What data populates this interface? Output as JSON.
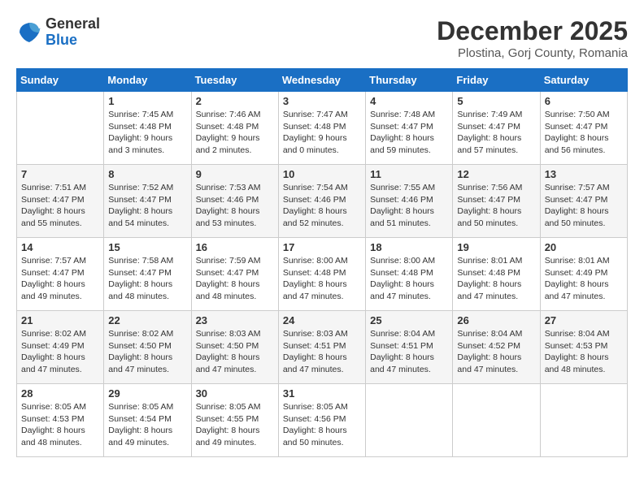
{
  "header": {
    "logo_general": "General",
    "logo_blue": "Blue",
    "month_year": "December 2025",
    "location": "Plostina, Gorj County, Romania"
  },
  "days_of_week": [
    "Sunday",
    "Monday",
    "Tuesday",
    "Wednesday",
    "Thursday",
    "Friday",
    "Saturday"
  ],
  "weeks": [
    [
      {
        "day": "",
        "sunrise": "",
        "sunset": "",
        "daylight": ""
      },
      {
        "day": "1",
        "sunrise": "Sunrise: 7:45 AM",
        "sunset": "Sunset: 4:48 PM",
        "daylight": "Daylight: 9 hours and 3 minutes."
      },
      {
        "day": "2",
        "sunrise": "Sunrise: 7:46 AM",
        "sunset": "Sunset: 4:48 PM",
        "daylight": "Daylight: 9 hours and 2 minutes."
      },
      {
        "day": "3",
        "sunrise": "Sunrise: 7:47 AM",
        "sunset": "Sunset: 4:48 PM",
        "daylight": "Daylight: 9 hours and 0 minutes."
      },
      {
        "day": "4",
        "sunrise": "Sunrise: 7:48 AM",
        "sunset": "Sunset: 4:47 PM",
        "daylight": "Daylight: 8 hours and 59 minutes."
      },
      {
        "day": "5",
        "sunrise": "Sunrise: 7:49 AM",
        "sunset": "Sunset: 4:47 PM",
        "daylight": "Daylight: 8 hours and 57 minutes."
      },
      {
        "day": "6",
        "sunrise": "Sunrise: 7:50 AM",
        "sunset": "Sunset: 4:47 PM",
        "daylight": "Daylight: 8 hours and 56 minutes."
      }
    ],
    [
      {
        "day": "7",
        "sunrise": "Sunrise: 7:51 AM",
        "sunset": "Sunset: 4:47 PM",
        "daylight": "Daylight: 8 hours and 55 minutes."
      },
      {
        "day": "8",
        "sunrise": "Sunrise: 7:52 AM",
        "sunset": "Sunset: 4:47 PM",
        "daylight": "Daylight: 8 hours and 54 minutes."
      },
      {
        "day": "9",
        "sunrise": "Sunrise: 7:53 AM",
        "sunset": "Sunset: 4:46 PM",
        "daylight": "Daylight: 8 hours and 53 minutes."
      },
      {
        "day": "10",
        "sunrise": "Sunrise: 7:54 AM",
        "sunset": "Sunset: 4:46 PM",
        "daylight": "Daylight: 8 hours and 52 minutes."
      },
      {
        "day": "11",
        "sunrise": "Sunrise: 7:55 AM",
        "sunset": "Sunset: 4:46 PM",
        "daylight": "Daylight: 8 hours and 51 minutes."
      },
      {
        "day": "12",
        "sunrise": "Sunrise: 7:56 AM",
        "sunset": "Sunset: 4:47 PM",
        "daylight": "Daylight: 8 hours and 50 minutes."
      },
      {
        "day": "13",
        "sunrise": "Sunrise: 7:57 AM",
        "sunset": "Sunset: 4:47 PM",
        "daylight": "Daylight: 8 hours and 50 minutes."
      }
    ],
    [
      {
        "day": "14",
        "sunrise": "Sunrise: 7:57 AM",
        "sunset": "Sunset: 4:47 PM",
        "daylight": "Daylight: 8 hours and 49 minutes."
      },
      {
        "day": "15",
        "sunrise": "Sunrise: 7:58 AM",
        "sunset": "Sunset: 4:47 PM",
        "daylight": "Daylight: 8 hours and 48 minutes."
      },
      {
        "day": "16",
        "sunrise": "Sunrise: 7:59 AM",
        "sunset": "Sunset: 4:47 PM",
        "daylight": "Daylight: 8 hours and 48 minutes."
      },
      {
        "day": "17",
        "sunrise": "Sunrise: 8:00 AM",
        "sunset": "Sunset: 4:48 PM",
        "daylight": "Daylight: 8 hours and 47 minutes."
      },
      {
        "day": "18",
        "sunrise": "Sunrise: 8:00 AM",
        "sunset": "Sunset: 4:48 PM",
        "daylight": "Daylight: 8 hours and 47 minutes."
      },
      {
        "day": "19",
        "sunrise": "Sunrise: 8:01 AM",
        "sunset": "Sunset: 4:48 PM",
        "daylight": "Daylight: 8 hours and 47 minutes."
      },
      {
        "day": "20",
        "sunrise": "Sunrise: 8:01 AM",
        "sunset": "Sunset: 4:49 PM",
        "daylight": "Daylight: 8 hours and 47 minutes."
      }
    ],
    [
      {
        "day": "21",
        "sunrise": "Sunrise: 8:02 AM",
        "sunset": "Sunset: 4:49 PM",
        "daylight": "Daylight: 8 hours and 47 minutes."
      },
      {
        "day": "22",
        "sunrise": "Sunrise: 8:02 AM",
        "sunset": "Sunset: 4:50 PM",
        "daylight": "Daylight: 8 hours and 47 minutes."
      },
      {
        "day": "23",
        "sunrise": "Sunrise: 8:03 AM",
        "sunset": "Sunset: 4:50 PM",
        "daylight": "Daylight: 8 hours and 47 minutes."
      },
      {
        "day": "24",
        "sunrise": "Sunrise: 8:03 AM",
        "sunset": "Sunset: 4:51 PM",
        "daylight": "Daylight: 8 hours and 47 minutes."
      },
      {
        "day": "25",
        "sunrise": "Sunrise: 8:04 AM",
        "sunset": "Sunset: 4:51 PM",
        "daylight": "Daylight: 8 hours and 47 minutes."
      },
      {
        "day": "26",
        "sunrise": "Sunrise: 8:04 AM",
        "sunset": "Sunset: 4:52 PM",
        "daylight": "Daylight: 8 hours and 47 minutes."
      },
      {
        "day": "27",
        "sunrise": "Sunrise: 8:04 AM",
        "sunset": "Sunset: 4:53 PM",
        "daylight": "Daylight: 8 hours and 48 minutes."
      }
    ],
    [
      {
        "day": "28",
        "sunrise": "Sunrise: 8:05 AM",
        "sunset": "Sunset: 4:53 PM",
        "daylight": "Daylight: 8 hours and 48 minutes."
      },
      {
        "day": "29",
        "sunrise": "Sunrise: 8:05 AM",
        "sunset": "Sunset: 4:54 PM",
        "daylight": "Daylight: 8 hours and 49 minutes."
      },
      {
        "day": "30",
        "sunrise": "Sunrise: 8:05 AM",
        "sunset": "Sunset: 4:55 PM",
        "daylight": "Daylight: 8 hours and 49 minutes."
      },
      {
        "day": "31",
        "sunrise": "Sunrise: 8:05 AM",
        "sunset": "Sunset: 4:56 PM",
        "daylight": "Daylight: 8 hours and 50 minutes."
      },
      {
        "day": "",
        "sunrise": "",
        "sunset": "",
        "daylight": ""
      },
      {
        "day": "",
        "sunrise": "",
        "sunset": "",
        "daylight": ""
      },
      {
        "day": "",
        "sunrise": "",
        "sunset": "",
        "daylight": ""
      }
    ]
  ]
}
